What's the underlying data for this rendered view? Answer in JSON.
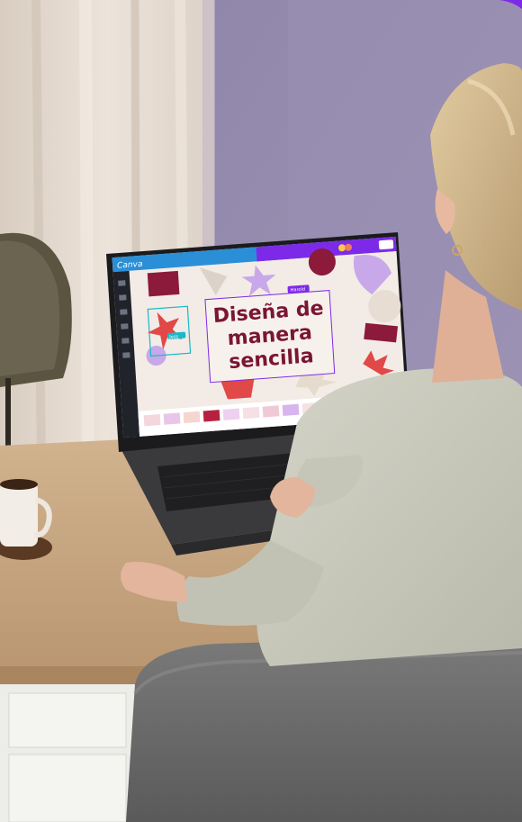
{
  "photo": {
    "description_free": true,
    "laptop_screen": {
      "app_logo": "Canva",
      "share_button": "Share",
      "title_lines": [
        "Diseña de",
        "manera",
        "sencilla"
      ],
      "selection_badge": "Harold",
      "cursor_badge": "Jess"
    }
  },
  "colors": {
    "wall": "#8f84a6",
    "curtain": "#e6dcd2",
    "desk": "#c9a985",
    "sweater": "#c9c9bc",
    "chair": "#6e6e6e",
    "hair": "#d4ba8f",
    "skin": "#e3b59d",
    "screen_bg": "#f3ebe6",
    "accent_red": "#e14848",
    "wine": "#8b1a3b",
    "lilac": "#c8a8e8",
    "canva_teal": "#19b9c8",
    "canva_purple": "#7d2ae8"
  },
  "icons": [
    "lamp",
    "coffee-cup",
    "laptop",
    "canva-logo"
  ]
}
